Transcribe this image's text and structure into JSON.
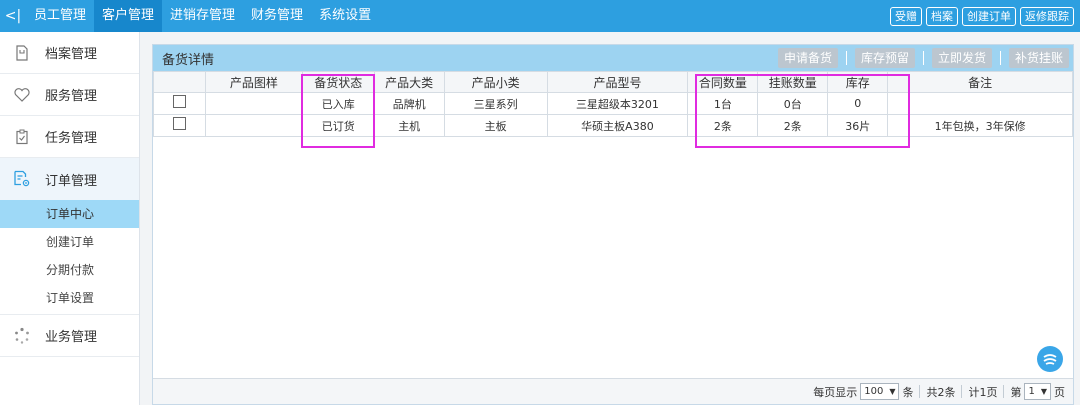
{
  "topbar": {
    "collapse_label": "<|",
    "nav": [
      "员工管理",
      "客户管理",
      "进销存管理",
      "财务管理",
      "系统设置"
    ],
    "actions": [
      "受赠",
      "档案",
      "创建订单",
      "返修跟踪"
    ]
  },
  "sidebar": {
    "items": [
      {
        "label": "档案管理",
        "icon": "file-icon"
      },
      {
        "label": "服务管理",
        "icon": "heart-icon"
      },
      {
        "label": "任务管理",
        "icon": "clipboard-check-icon"
      },
      {
        "label": "订单管理",
        "icon": "order-gear-icon"
      },
      {
        "label": "业务管理",
        "icon": "spinner-dots-icon"
      }
    ],
    "subitems": [
      "订单中心",
      "创建订单",
      "分期付款",
      "订单设置"
    ]
  },
  "panel": {
    "title": "备货详情",
    "buttons": [
      "申请备货",
      "库存预留",
      "立即发货",
      "补货挂账"
    ]
  },
  "table": {
    "headers": [
      "",
      "产品图样",
      "备货状态",
      "产品大类",
      "产品小类",
      "产品型号",
      "合同数量",
      "挂账数量",
      "库存",
      "备注"
    ],
    "rows": [
      [
        "",
        "",
        "已入库",
        "品牌机",
        "三星系列",
        "三星超级本3201",
        "1台",
        "0台",
        "0",
        ""
      ],
      [
        "",
        "",
        "已订货",
        "主机",
        "主板",
        "华硕主板A380",
        "2条",
        "2条",
        "36片",
        "1年包换，3年保修"
      ]
    ]
  },
  "pager": {
    "per_page_label": "每页显示",
    "per_page_value": "100",
    "unit": "条",
    "total": "共2条",
    "pages": "计1页",
    "page_prefix": "第",
    "page_value": "1",
    "page_suffix": "页"
  },
  "colors": {
    "topbar": "#2d9fe0",
    "panel_header": "#9dd3f1",
    "highlight": "#e02be0",
    "active_subitem": "#9ed9f7"
  }
}
